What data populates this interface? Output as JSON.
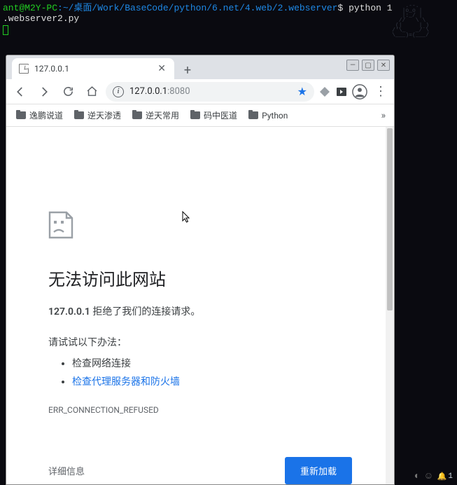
{
  "terminal": {
    "user_host": "ant@M2Y-PC",
    "sep": ":",
    "path": "~/桌面/Work/BaseCode/python/6.net/4.web/2.webserver",
    "prompt": "$",
    "cmd_partial": "python 1",
    "line2": ".webserver2.py"
  },
  "tray": {
    "badge_count": "1"
  },
  "window": {
    "tab_title": "127.0.0.1",
    "url_host": "127.0.0.1",
    "url_port": ":8080"
  },
  "bookmarks": {
    "items": [
      "逸鹏说道",
      "逆天渗透",
      "逆天常用",
      "码中医道",
      "Python"
    ]
  },
  "error": {
    "title": "无法访问此网站",
    "host": "127.0.0.1",
    "sub_tail": " 拒绝了我们的连接请求。",
    "try_label": "请试试以下办法：",
    "check_network": "检查网络连接",
    "check_proxy": "检查代理服务器和防火墙",
    "code": "ERR_CONNECTION_REFUSED",
    "details": "详细信息",
    "reload": "重新加载"
  }
}
